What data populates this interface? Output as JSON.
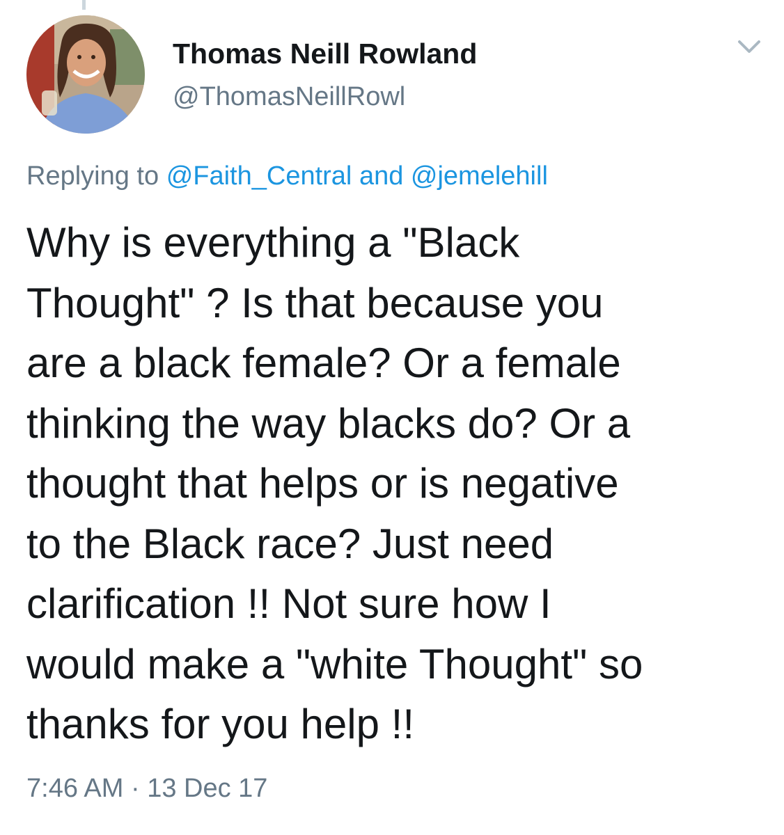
{
  "author": {
    "display_name": "Thomas Neill Rowland",
    "handle": "@ThomasNeillRowl",
    "avatar_icon": "profile-photo"
  },
  "menu": {
    "icon": "chevron-down-icon"
  },
  "reply": {
    "prefix": "Replying to",
    "mention_1": "@Faith_Central",
    "connector": "and",
    "mention_2": "@jemelehill"
  },
  "tweet": {
    "lines": [
      "Why is everything a \"Black",
      "Thought\" ? Is that because you",
      "are a black female? Or a female",
      "thinking the way blacks do? Or a",
      "thought that helps or is negative",
      "to the Black race? Just need",
      "clarification !! Not sure how I",
      "would make a \"white Thought\" so",
      "thanks for you help !!"
    ]
  },
  "meta": {
    "time": "7:46 AM",
    "separator": "·",
    "date": "13 Dec 17"
  },
  "colors": {
    "primary_text": "#14171a",
    "secondary_text": "#657786",
    "link": "#1b95e0",
    "divider": "#ccd6dd"
  }
}
